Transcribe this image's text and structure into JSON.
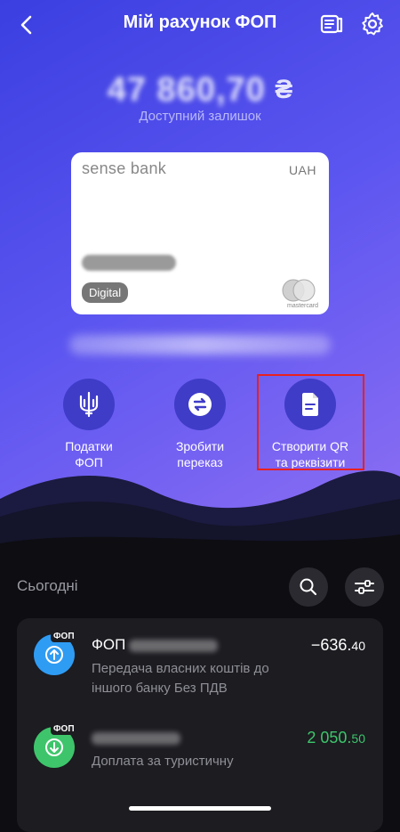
{
  "header": {
    "title": "Мій рахунок ФОП"
  },
  "balance": {
    "amount": "47 860,70",
    "currency": "₴",
    "label": "Доступний залишок"
  },
  "card": {
    "brand": "sense bank",
    "currency": "UAH",
    "type": "Digital",
    "network": "mastercard"
  },
  "actions": [
    {
      "label": "Податки\nФОП",
      "icon": "tryzub-icon"
    },
    {
      "label": "Зробити\nпереказ",
      "icon": "transfer-icon"
    },
    {
      "label": "Створити QR\nта реквізити",
      "icon": "document-icon"
    }
  ],
  "section": {
    "title": "Сьогодні"
  },
  "transactions": [
    {
      "badge": "ФОП",
      "name": "ФОП",
      "description": "Передача власних коштів до іншого банку Без ПДВ",
      "amount_main": "−636.",
      "amount_cents": "40",
      "color": "#ffffff",
      "icon_bg": "#2f9cf4"
    },
    {
      "badge": "ФОП",
      "name": "",
      "description": "Доплата за туристичну",
      "amount_main": "2 050.",
      "amount_cents": "50",
      "color": "#3ec56b",
      "icon_bg": "#3ec56b"
    }
  ],
  "colors": {
    "accent": "#3f3cc8",
    "highlight": "#e8201f",
    "income": "#3ec56b"
  }
}
